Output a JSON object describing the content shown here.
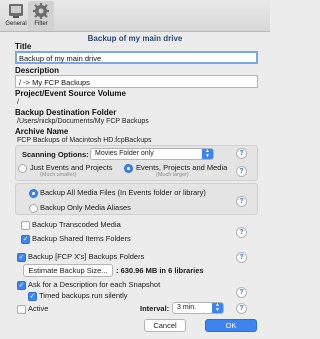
{
  "toolbar": {
    "general_label": "General",
    "filter_label": "Filter"
  },
  "window_title": "Backup of my main drive",
  "title_section": {
    "label": "Title",
    "value": "Backup of my main drive"
  },
  "description_section": {
    "label": "Description",
    "value": "/ -> My FCP Backups"
  },
  "source_section": {
    "label": "Project/Event Source Volume",
    "value": "/"
  },
  "dest_section": {
    "label": "Backup Destination Folder",
    "value": "/Users/nickp/Documents/My FCP Backups"
  },
  "archive_section": {
    "label": "Archive Name",
    "value": "FCP Backups of Macintosh HD.fcpBackups"
  },
  "scanning": {
    "label": "Scanning Options:",
    "selected": "Movies Folder only",
    "option_just": "Just Events and Projects",
    "option_just_note": "(Much smaller)",
    "option_events": "Events, Projects and Media",
    "option_events_note": "(Much larger)"
  },
  "media": {
    "backup_all": "Backup All Media Files (In Events folder or library)",
    "backup_only_aliases": "Backup Only Media Aliases"
  },
  "options": {
    "transcoded": "Backup Transcoded Media",
    "shared": "Backup Shared Items Folders",
    "fcpx_folders": "Backup [FCP X's] Backups Folders",
    "estimate_button": "Estimate Backup Size...",
    "estimate_result": ": 630.96 MB in 6 libraries",
    "ask_description": "Ask for a Description for each Snapshot",
    "timed_silently": "Timed backups run silently",
    "active": "Active",
    "interval_label": "Interval:",
    "interval_value": "3 min."
  },
  "buttons": {
    "cancel": "Cancel",
    "ok": "OK"
  },
  "help_glyph": "?",
  "colors": {
    "accent": "#3d84f0",
    "title": "#2c4a7a"
  }
}
